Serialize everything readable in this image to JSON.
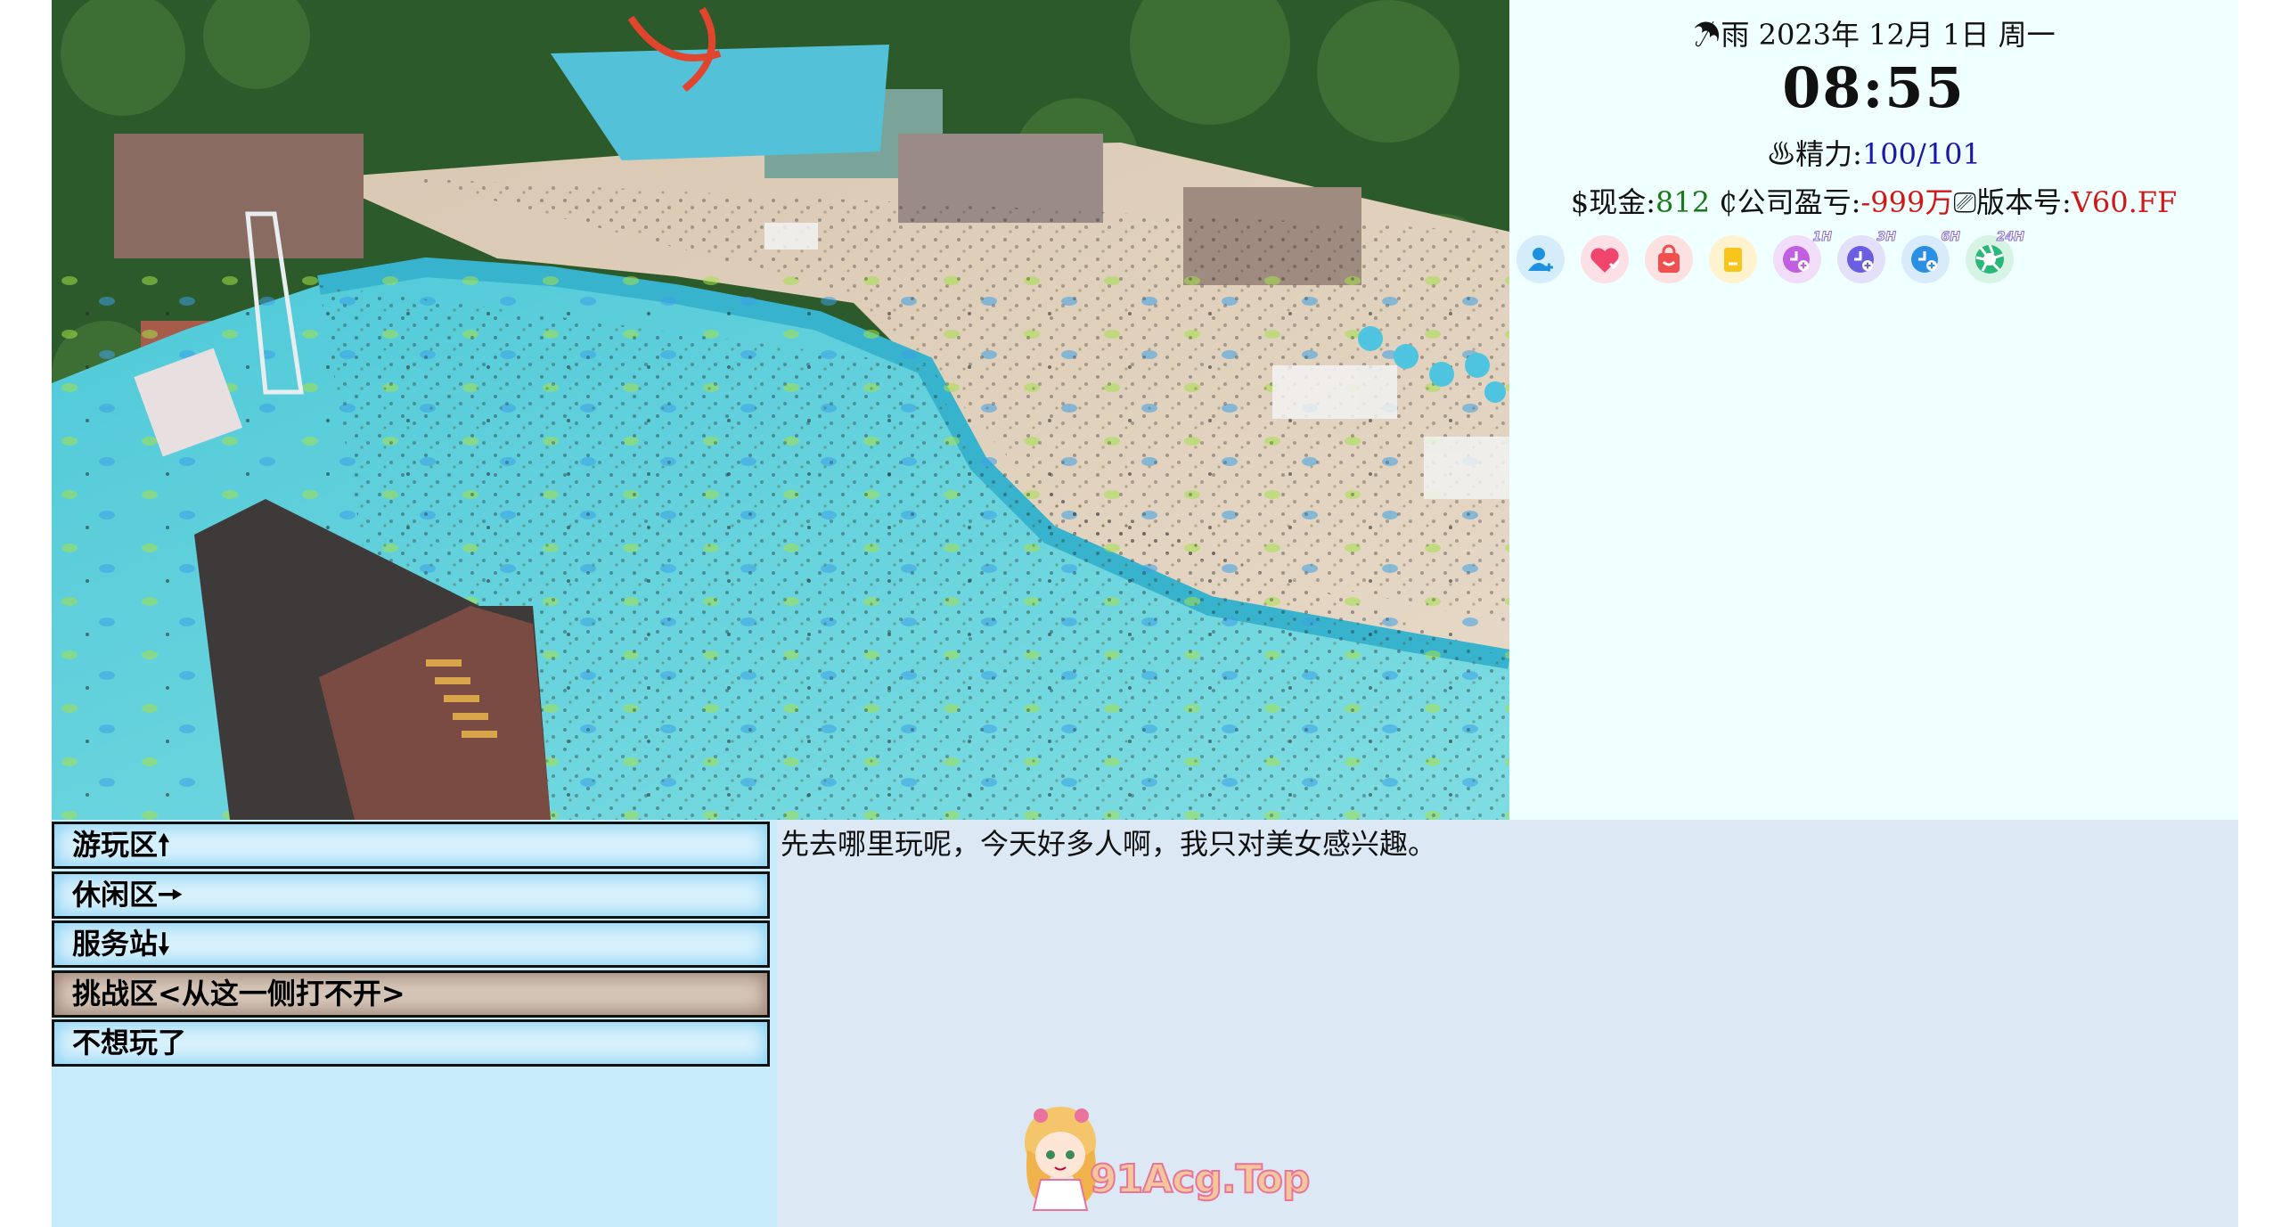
{
  "status": {
    "weather_icon": "umbrella-icon",
    "weather_glyph": "☂",
    "weather": "雨",
    "date": "2023年 12月 1日 周一",
    "time": "08:55",
    "energy_glyph": "♨",
    "energy_label": "精力:",
    "energy_value": "100/101",
    "money_glyph": "$",
    "money_label": "现金:",
    "money_value": "812",
    "company_glyph": "₵",
    "company_label": "公司盈亏:",
    "company_value": "-999万",
    "version_glyph": "⎚",
    "version_label": "版本号:",
    "version_value": "V60.FF"
  },
  "apps": [
    {
      "name": "contacts-app-icon",
      "color": "#1e90e0",
      "bg": "#d5ecfb",
      "badge": ""
    },
    {
      "name": "favorites-app-icon",
      "color": "#f0466e",
      "bg": "#fde0e6",
      "badge": ""
    },
    {
      "name": "shop-app-icon",
      "color": "#f05050",
      "bg": "#fde0e0",
      "badge": ""
    },
    {
      "name": "notes-app-icon",
      "color": "#f7c51b",
      "bg": "#fff3cf",
      "badge": ""
    },
    {
      "name": "wait-1h-icon",
      "color": "#c15fe0",
      "bg": "#f1ddfa",
      "badge": "1H"
    },
    {
      "name": "wait-3h-icon",
      "color": "#6c5ee0",
      "bg": "#e4e0fa",
      "badge": "3H"
    },
    {
      "name": "wait-6h-icon",
      "color": "#2b8fe6",
      "bg": "#d8ebfb",
      "badge": "6H"
    },
    {
      "name": "wait-24h-icon",
      "color": "#2ab87a",
      "bg": "#d6f3e4",
      "badge": "24H"
    }
  ],
  "choices": [
    {
      "label": "游玩区🠕",
      "locked": false
    },
    {
      "label": "休闲区🠖",
      "locked": false
    },
    {
      "label": "服务站🠗",
      "locked": false
    },
    {
      "label": "挑战区<从这一侧打不开>",
      "locked": true
    },
    {
      "label": "不想玩了",
      "locked": false
    }
  ],
  "dialog": "先去哪里玩呢，今天好多人啊，我只对美女感兴趣。",
  "watermark": "91Acg.Top",
  "colors": {
    "status_bg": "#f0ffff",
    "choice_bg": "#c8ecfb",
    "dialog_bg": "#dce8f4",
    "energy": "#1a1aa6",
    "money": "#1a7a1a",
    "alert": "#d01818"
  }
}
